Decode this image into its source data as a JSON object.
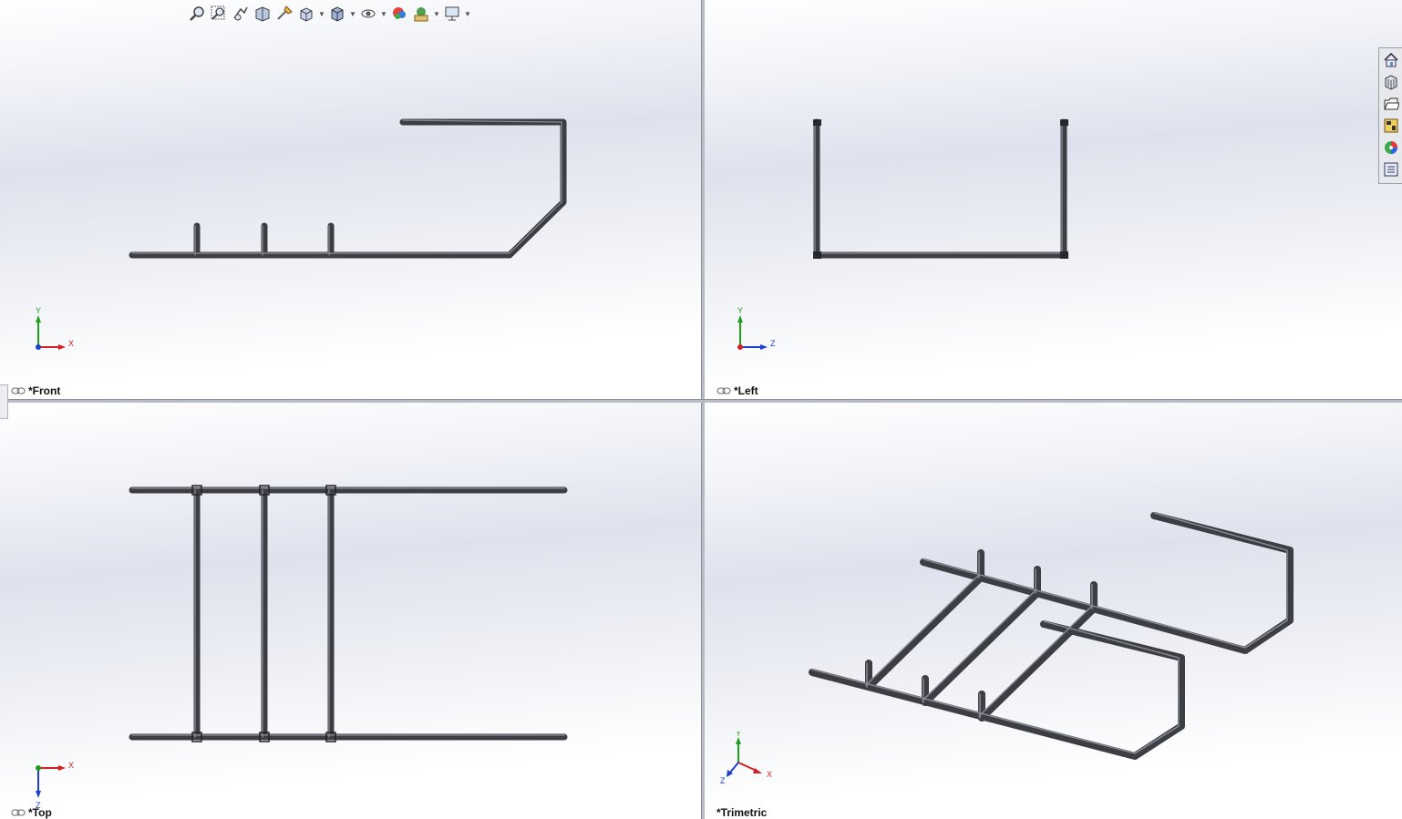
{
  "views": {
    "front": {
      "label": "*Front",
      "axes": {
        "vertical": "Y",
        "horizontal": "X"
      }
    },
    "left": {
      "label": "*Left",
      "axes": {
        "vertical": "Y",
        "horizontal": "Z"
      }
    },
    "top": {
      "label": "*Top",
      "axes": {
        "vertical": "Z",
        "horizontal": "X"
      }
    },
    "trimetric": {
      "label": "*Trimetric",
      "axes": {
        "vertical": "Y",
        "horizontal": "X",
        "depth": "Z"
      }
    }
  },
  "toolbar": {
    "icons": [
      "zoom-to-fit-icon",
      "zoom-to-area-icon",
      "previous-view-icon",
      "section-view-icon",
      "dynamic-annotation-icon",
      "view-orientation-icon",
      "display-style-icon",
      "hide-show-items-icon",
      "edit-appearance-icon",
      "apply-scene-icon",
      "view-settings-icon"
    ]
  },
  "taskpane": {
    "icons": [
      "home-icon",
      "design-library-icon",
      "file-explorer-icon",
      "view-palette-icon",
      "appearances-icon",
      "custom-properties-icon"
    ]
  },
  "colors": {
    "tube": "#3c3e44",
    "tube_highlight": "#8a8e98",
    "axis_x": "#d42020",
    "axis_y": "#1ea01e",
    "axis_z": "#1c3fd0"
  }
}
